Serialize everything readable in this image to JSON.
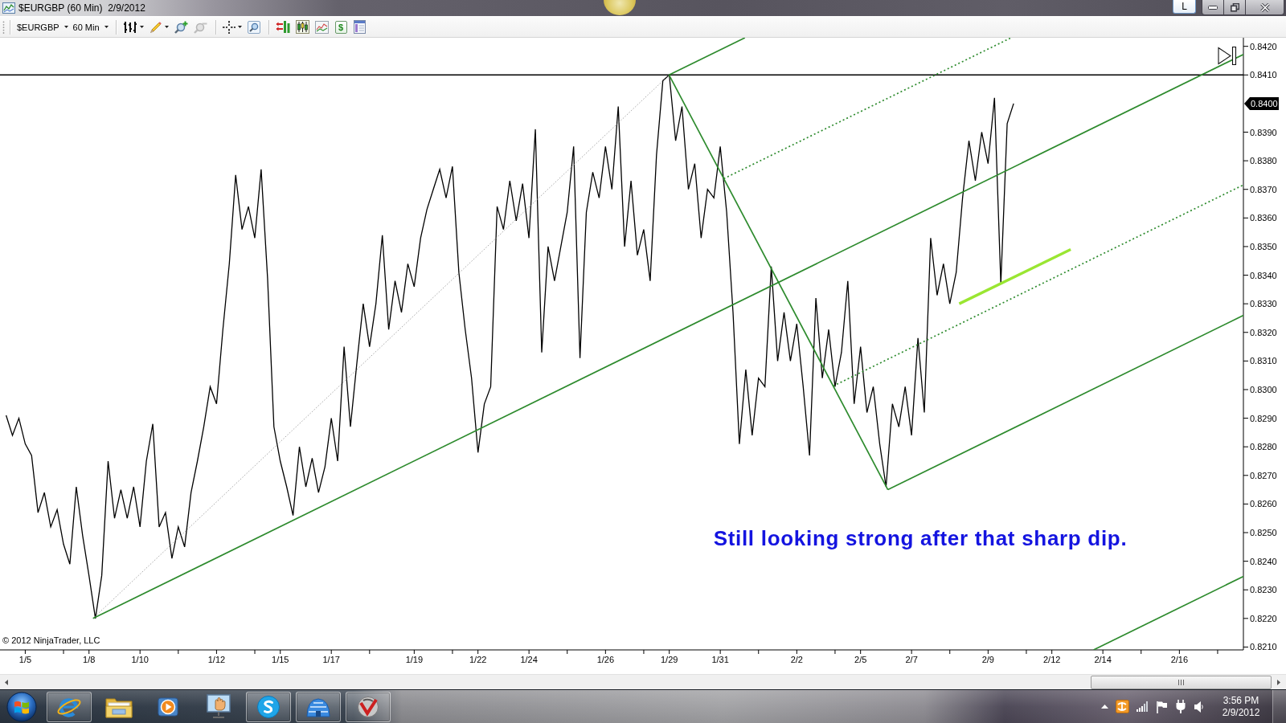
{
  "window": {
    "title": "$EURGBP (60 Min)  2/9/2012",
    "extra_button": {
      "label": "L"
    }
  },
  "toolbar": {
    "instrument": {
      "label": "$EURGBP"
    },
    "interval": {
      "label": "60 Min"
    },
    "zoom_out": {
      "disabled": true
    },
    "dollar_button": {
      "label": "$"
    }
  },
  "chart": {
    "chart_data": {
      "type": "line",
      "categories": [
        null,
        null,
        null,
        "1/5",
        null,
        null,
        null,
        null,
        null,
        null,
        null,
        null,
        null,
        "1/8",
        null,
        null,
        null,
        null,
        null,
        null,
        null,
        "1/10",
        null,
        null,
        null,
        null,
        null,
        null,
        null,
        null,
        null,
        null,
        null,
        "1/12",
        null,
        null,
        null,
        null,
        null,
        null,
        null,
        null,
        null,
        "1/15",
        null,
        null,
        null,
        null,
        null,
        null,
        null,
        "1/17",
        null,
        null,
        null,
        null,
        null,
        null,
        null,
        null,
        null,
        null,
        null,
        null,
        "1/19",
        null,
        null,
        null,
        null,
        null,
        null,
        null,
        null,
        null,
        "1/22",
        null,
        null,
        null,
        null,
        null,
        null,
        null,
        "1/24",
        null,
        null,
        null,
        null,
        null,
        null,
        null,
        null,
        null,
        null,
        null,
        "1/26",
        null,
        null,
        null,
        null,
        null,
        null,
        null,
        null,
        null,
        "1/29",
        null,
        null,
        null,
        null,
        null,
        null,
        null,
        "1/31",
        null,
        null,
        null,
        null,
        null,
        null,
        null,
        null,
        null,
        null,
        null,
        "2/2",
        null,
        null,
        null,
        null,
        null,
        null,
        null,
        null,
        null,
        "2/5",
        null,
        null,
        null,
        null,
        null,
        null,
        null,
        "2/7",
        null,
        null,
        null,
        null,
        null,
        null,
        null,
        null,
        null,
        null,
        null,
        "2/9",
        null,
        null,
        null,
        null,
        null,
        null,
        null,
        null,
        null,
        "2/12",
        null,
        null,
        null,
        null,
        null,
        null,
        null,
        "2/14",
        null,
        null,
        null,
        null,
        null,
        null,
        null,
        null,
        null,
        null,
        null,
        "2/16",
        null,
        null,
        null,
        null,
        null,
        null,
        null,
        null,
        null,
        null
      ],
      "series": [
        {
          "color": "#000000",
          "values": [
            0.8291,
            0.8284,
            0.829,
            0.8281,
            0.8277,
            0.8257,
            0.8264,
            0.8252,
            0.8258,
            0.8246,
            0.8239,
            0.8266,
            0.8249,
            0.8235,
            0.822,
            0.8235,
            0.8275,
            0.8255,
            0.8265,
            0.8255,
            0.8266,
            0.8252,
            0.8275,
            0.8288,
            0.8252,
            0.8257,
            0.8241,
            0.8252,
            0.8245,
            0.8264,
            0.8275,
            0.8287,
            0.8301,
            0.8295,
            0.8321,
            0.8344,
            0.8375,
            0.8356,
            0.8364,
            0.8353,
            0.8377,
            0.8339,
            0.8287,
            0.8275,
            0.8266,
            0.8256,
            0.828,
            0.8266,
            0.8276,
            0.8264,
            0.8273,
            0.829,
            0.8275,
            0.8315,
            0.8287,
            0.8309,
            0.833,
            0.8315,
            0.833,
            0.8354,
            0.8321,
            0.8338,
            0.8327,
            0.8344,
            0.8336,
            0.8353,
            0.8363,
            0.837,
            0.8377,
            0.8367,
            0.8378,
            0.8341,
            0.8321,
            0.8304,
            0.8278,
            0.8295,
            0.8301,
            0.8364,
            0.8356,
            0.8373,
            0.8359,
            0.8372,
            0.8353,
            0.8391,
            0.8313,
            0.835,
            0.8338,
            0.835,
            0.8362,
            0.8385,
            0.8311,
            0.8362,
            0.8376,
            0.8367,
            0.8385,
            0.837,
            0.8399,
            0.835,
            0.8373,
            0.8347,
            0.8356,
            0.8338,
            0.8382,
            0.8408,
            0.841,
            0.8387,
            0.8399,
            0.837,
            0.8379,
            0.8353,
            0.837,
            0.8367,
            0.8385,
            0.8362,
            0.8327,
            0.8281,
            0.8307,
            0.8284,
            0.8304,
            0.8301,
            0.8343,
            0.831,
            0.8327,
            0.831,
            0.8323,
            0.8301,
            0.8277,
            0.8332,
            0.8304,
            0.8321,
            0.8301,
            0.8313,
            0.8338,
            0.8295,
            0.8315,
            0.8292,
            0.8301,
            0.8281,
            0.8266,
            0.8295,
            0.8287,
            0.8301,
            0.8284,
            0.8318,
            0.8292,
            0.8353,
            0.8333,
            0.8344,
            0.833,
            0.8341,
            0.8367,
            0.8387,
            0.8373,
            0.839,
            0.8379,
            0.8402,
            0.8337,
            0.8393,
            0.84,
            null,
            null,
            null,
            null,
            null,
            null,
            null,
            null,
            null,
            null,
            null,
            null,
            null,
            null,
            null,
            null,
            null,
            null,
            null,
            null,
            null,
            null,
            null,
            null,
            null,
            null,
            null,
            null,
            null,
            null,
            null,
            null,
            null,
            null,
            null,
            null
          ]
        }
      ],
      "ylim": [
        0.8209,
        0.8423
      ],
      "yticks": [
        {
          "value": 0.842,
          "label": "0.8420"
        },
        {
          "value": 0.841,
          "label": "0.8410"
        },
        {
          "value": 0.839,
          "label": "0.8390"
        },
        {
          "value": 0.838,
          "label": "0.8380"
        },
        {
          "value": 0.837,
          "label": "0.8370"
        },
        {
          "value": 0.836,
          "label": "0.8360"
        },
        {
          "value": 0.835,
          "label": "0.8350"
        },
        {
          "value": 0.834,
          "label": "0.8340"
        },
        {
          "value": 0.833,
          "label": "0.8330"
        },
        {
          "value": 0.832,
          "label": "0.8320"
        },
        {
          "value": 0.831,
          "label": "0.8310"
        },
        {
          "value": 0.83,
          "label": "0.8300"
        },
        {
          "value": 0.829,
          "label": "0.8290"
        },
        {
          "value": 0.828,
          "label": "0.8280"
        },
        {
          "value": 0.827,
          "label": "0.8270"
        },
        {
          "value": 0.826,
          "label": "0.8260"
        },
        {
          "value": 0.825,
          "label": "0.8250"
        },
        {
          "value": 0.824,
          "label": "0.8240"
        },
        {
          "value": 0.823,
          "label": "0.8230"
        },
        {
          "value": 0.822,
          "label": "0.8220"
        },
        {
          "value": 0.821,
          "label": "0.8210"
        }
      ],
      "annotations": [
        "Still looking strong after that sharp dip."
      ]
    },
    "last_price": "0.8400",
    "copyright": "© 2012 NinjaTrader, LLC"
  },
  "taskbar": {
    "apps": [
      {
        "kind": "browser",
        "running": true
      },
      {
        "kind": "folder",
        "running": false
      },
      {
        "kind": "player",
        "running": false
      },
      {
        "kind": "remote",
        "running": false
      },
      {
        "kind": "chat",
        "running": true
      },
      {
        "kind": "dome",
        "running": true
      },
      {
        "kind": "trading",
        "running": true
      }
    ],
    "clock": {
      "time": "3:56 PM",
      "date": "2/9/2012"
    }
  }
}
